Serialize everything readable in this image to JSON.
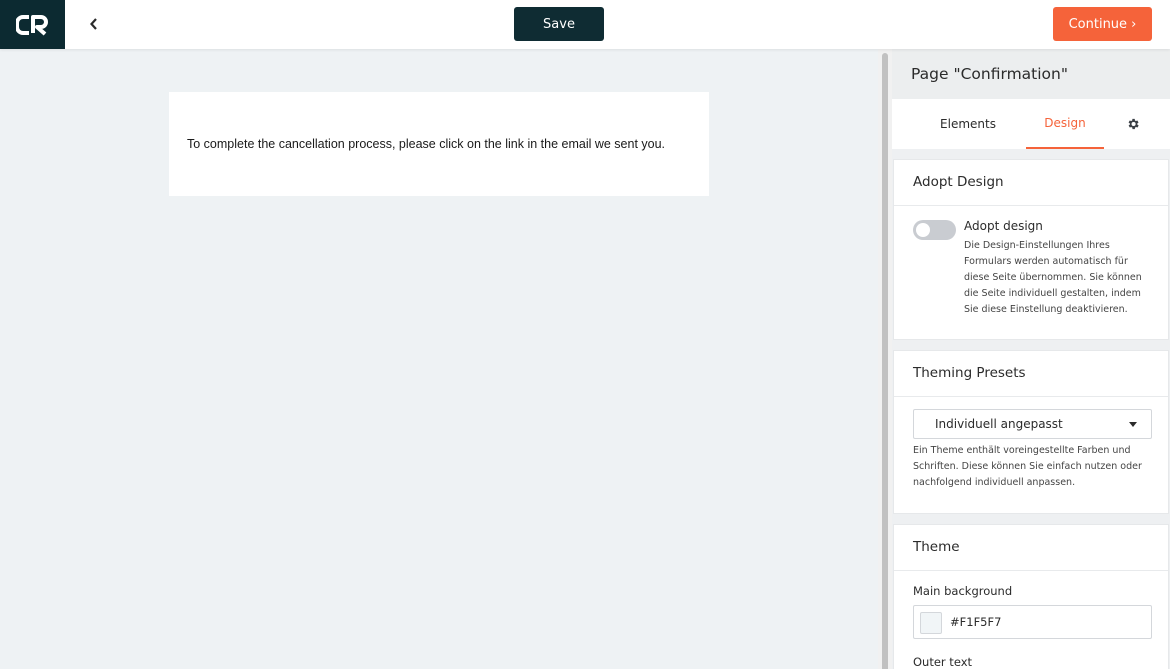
{
  "topbar": {
    "save_label": "Save",
    "continue_label": "Continue ›"
  },
  "canvas": {
    "confirmation_text": "To complete the cancellation process, please click on the link in the email we sent you."
  },
  "panel": {
    "title": "Page \"Confirmation\"",
    "tabs": {
      "elements": "Elements",
      "design": "Design"
    },
    "adopt": {
      "title": "Adopt Design",
      "toggle_label": "Adopt design",
      "toggle_on": false,
      "description": "Die Design-Einstellungen Ihres Formulars werden automatisch für diese Seite übernommen. Sie können die Seite individuell gestalten, indem Sie diese Einstellung deaktivieren."
    },
    "presets": {
      "title": "Theming Presets",
      "selected": "Individuell angepasst",
      "description": "Ein Theme enthält voreingestellte Farben und Schriften. Diese können Sie einfach nutzen oder nachfolgend individuell anpassen."
    },
    "theme": {
      "title": "Theme",
      "main_background_label": "Main background",
      "main_background_value": "#F1F5F7",
      "outer_text_label": "Outer text"
    }
  },
  "colors": {
    "logo_bg": "#0c2a31",
    "save_bg": "#0f2c33",
    "accent": "#f5633a",
    "canvas_bg": "#eef2f4"
  },
  "icons": {
    "logo": "cr-logo",
    "back": "chevron-left-icon",
    "settings": "gear-icon",
    "dropdown": "caret-down-icon"
  }
}
